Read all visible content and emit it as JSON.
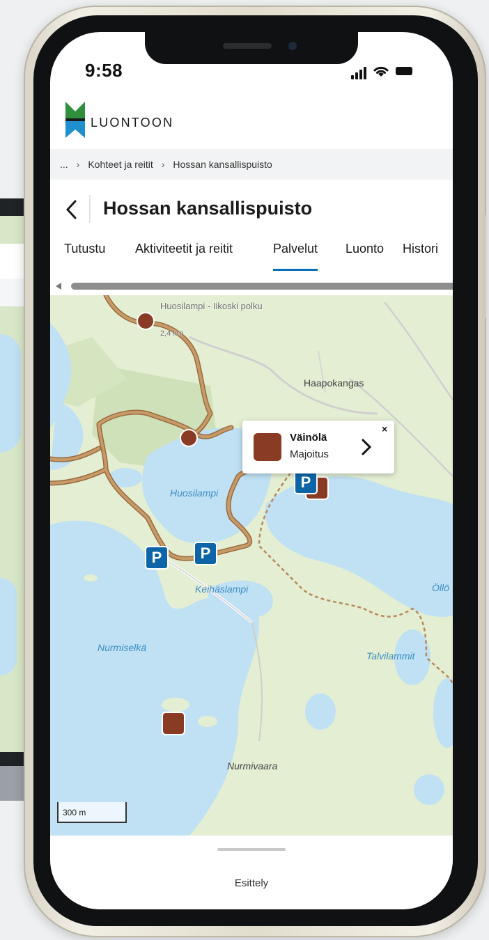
{
  "status_bar": {
    "time": "9:58"
  },
  "brand": {
    "name": "LUONTOON"
  },
  "breadcrumb": {
    "ellipsis": "...",
    "items": [
      "Kohteet ja reitit",
      "Hossan kansallispuisto"
    ]
  },
  "header": {
    "title": "Hossan kansallispuisto"
  },
  "tabs": [
    {
      "label": "Tutustu",
      "active": false
    },
    {
      "label": "Aktiviteetit ja reitit",
      "active": false
    },
    {
      "label": "Palvelut",
      "active": true
    },
    {
      "label": "Luonto",
      "active": false
    },
    {
      "label": "Histori",
      "active": false
    }
  ],
  "map": {
    "labels": {
      "trail_name": "Huosilampi - Iikoski polku",
      "trail_length": "2,4 km",
      "haapokangas": "Haapokangas",
      "huosilampi": "Huosilampi",
      "keihaslampi": "Keihäslampi",
      "nurmiselka": "Nurmiselkä",
      "talvilammit": "Talvilammit",
      "ollo": "Öllö",
      "nurmivaara": "Nurmivaara"
    },
    "parking_label": "P",
    "popup": {
      "title": "Väinölä",
      "subtitle": "Majoitus",
      "close": "×"
    },
    "scale": "300 m",
    "colors": {
      "land": "#e4eed3",
      "water": "#bfe1f3",
      "trail": "#b88a5a",
      "parking": "#0d65a8",
      "poi": "#8a3b24"
    }
  },
  "bottom_sheet": {
    "label": "Esittely"
  }
}
